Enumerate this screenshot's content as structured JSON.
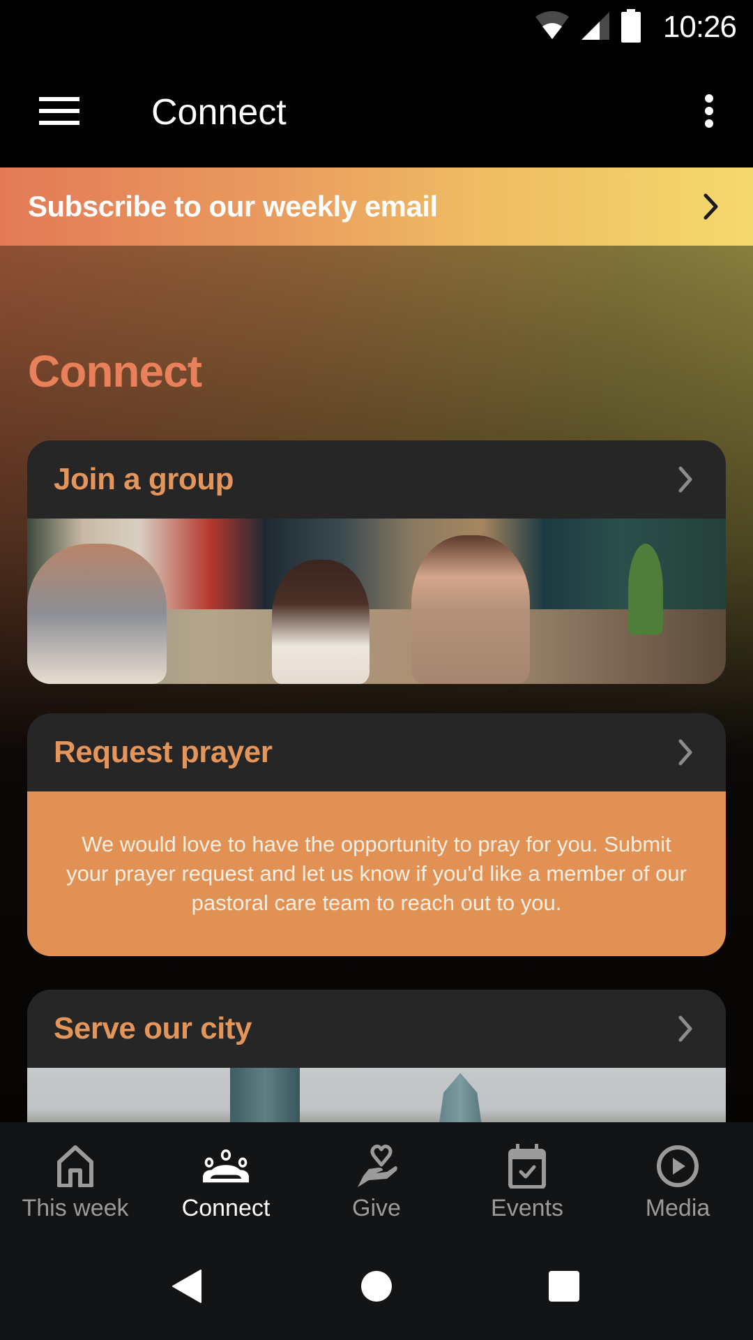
{
  "status_bar": {
    "time": "10:26",
    "icons": [
      "wifi-icon",
      "cell-signal-icon",
      "battery-icon"
    ]
  },
  "app_bar": {
    "title": "Connect",
    "menu_icon": "hamburger-menu-icon",
    "overflow_icon": "more-vert-icon"
  },
  "banner": {
    "label": "Subscribe to our weekly email",
    "icon": "chevron-right-icon"
  },
  "section": {
    "heading": "Connect"
  },
  "cards": [
    {
      "title": "Join a group",
      "media": "photo: small group of people talking on a couch"
    },
    {
      "title": "Request prayer",
      "body": "We would love to have the opportunity to pray for you. Submit your prayer request and let us know if you'd like a member of our pastoral care team to reach out to you."
    },
    {
      "title": "Serve our city",
      "media": "photo: city skyline"
    }
  ],
  "bottom_nav": {
    "items": [
      {
        "label": "This week",
        "icon": "home-icon",
        "active": false
      },
      {
        "label": "Connect",
        "icon": "groups-icon",
        "active": true
      },
      {
        "label": "Give",
        "icon": "give-heart-hand-icon",
        "active": false
      },
      {
        "label": "Events",
        "icon": "calendar-check-icon",
        "active": false
      },
      {
        "label": "Media",
        "icon": "play-circle-icon",
        "active": false
      }
    ]
  },
  "system_nav": {
    "buttons": [
      "back",
      "home",
      "recents"
    ]
  },
  "colors": {
    "accent_heading": "#e8805a",
    "card_title": "#e3955a",
    "card_bg": "#262626",
    "prayer_bg": "#e19154",
    "banner_start": "#e37a57",
    "banner_end": "#f4d96c",
    "nav_bg": "#131416",
    "nav_inactive": "#9b9b9b",
    "nav_active": "#ffffff"
  }
}
